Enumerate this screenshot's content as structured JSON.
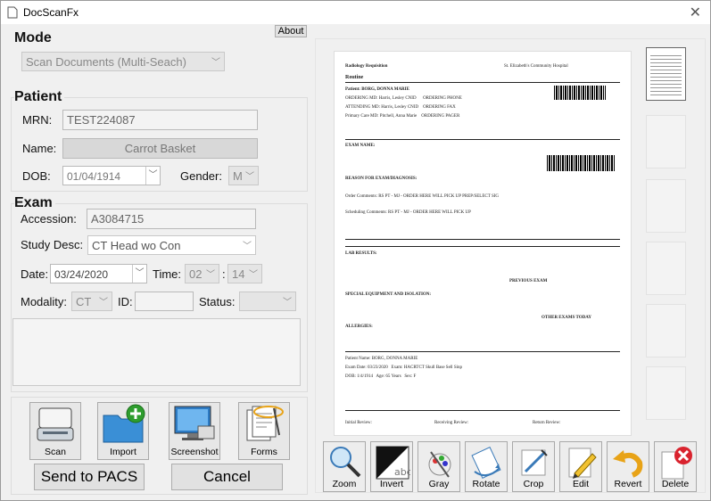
{
  "window": {
    "title": "DocScanFx",
    "about_label": "About"
  },
  "mode": {
    "heading": "Mode",
    "selected": "Scan Documents (Multi-Seach)"
  },
  "patient": {
    "heading": "Patient",
    "mrn_label": "MRN:",
    "mrn_value": "TEST224087",
    "name_label": "Name:",
    "name_value": "Carrot Basket",
    "dob_label": "DOB:",
    "dob_value": "01/04/1914",
    "gender_label": "Gender:",
    "gender_value": "M"
  },
  "exam": {
    "heading": "Exam",
    "accession_label": "Accession:",
    "accession_value": "A3084715",
    "study_label": "Study Desc:",
    "study_value": "CT Head wo Con",
    "date_label": "Date:",
    "date_value": "03/24/2020",
    "time_label": "Time:",
    "hour": "02",
    "colon": ":",
    "minute": "14",
    "modality_label": "Modality:",
    "modality_value": "CT",
    "id_label": "ID:",
    "id_value": "",
    "status_label": "Status:",
    "status_value": ""
  },
  "actions": {
    "scan": "Scan",
    "import": "Import",
    "screenshot": "Screenshot",
    "forms": "Forms",
    "send": "Send to PACS",
    "cancel": "Cancel"
  },
  "tools": [
    "Zoom",
    "Invert",
    "Gray",
    "Rotate",
    "Crop",
    "Edit",
    "Revert",
    "Delete"
  ],
  "document": {
    "l1": "Radiology Requisition",
    "l1r": "St. Elizabeth's Community Hospital",
    "l2": "Routine",
    "l3": "Patient: BORG, DONNA MARIE",
    "l4": "EXAM NAME:",
    "l5": "REASON FOR EXAM/DIAGNOSIS:",
    "l6": "LAB RESULTS:",
    "l7": "SPECIAL EQUIPMENT AND ISOLATION:",
    "l8": "PREVIOUS EXAM",
    "l9": "OTHER EXAMS TODAY",
    "l10": "ALLERGIES:",
    "l11": "Patient Name: BORG, DONNA MARIE",
    "l12": "Initial Review:",
    "l13": "Receiving Review:",
    "l14": "Return Review:"
  },
  "colors": {
    "accent_green": "#2e9d2e",
    "delete_red": "#d9232e",
    "folder_blue": "#3a8fd6"
  }
}
